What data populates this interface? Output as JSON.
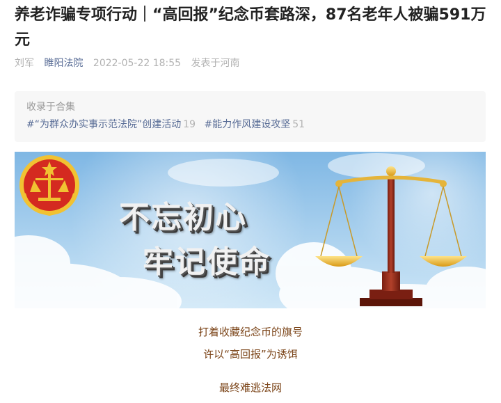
{
  "article": {
    "title": "养老诈骗专项行动｜“高回报”纪念币套路深，87名老年人被骗591万元",
    "author": "刘军",
    "account": "睢阳法院",
    "datetime": "2022-05-22 18:55",
    "location": "发表于河南"
  },
  "collection": {
    "header": "收录于合集",
    "tags": [
      {
        "label": "#“为群众办实事示范法院”创建活动",
        "count": "19"
      },
      {
        "label": "#能力作风建设攻坚",
        "count": "51"
      }
    ]
  },
  "banner": {
    "line1": "不忘初心",
    "line2": "牢记使命"
  },
  "body_lines": [
    "打着收藏纪念币的旗号",
    "许以“高回报”为诱饵",
    "最终难逃法网"
  ],
  "colors": {
    "sky_top": "#7fb7e4",
    "sky_bottom": "#cfe7f7",
    "emblem_red": "#d42a20",
    "emblem_gold": "#f1c232",
    "body_text": "#7b4418",
    "link": "#576b95"
  }
}
